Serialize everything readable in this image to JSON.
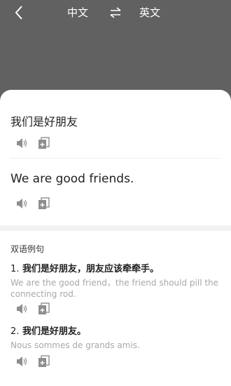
{
  "header": {
    "source_lang": "中文",
    "target_lang": "英文",
    "icons": {
      "back": "chevron-left-icon",
      "swap": "swap-arrows-icon"
    }
  },
  "translation": {
    "source_text": "我们是好朋友",
    "target_text": "We are good friends."
  },
  "examples": {
    "title": "双语例句",
    "items": [
      {
        "number": "1.",
        "cn": "我们是好朋友，朋友应该牵牵手。",
        "en": "We are the good friend，the friend should pill the connecting rod."
      },
      {
        "number": "2.",
        "cn": "我们是好朋友。",
        "en": "Nous sommes de grands amis."
      }
    ]
  },
  "colors": {
    "header_bg": "#616161",
    "card_bg": "#ffffff",
    "muted_text": "#a8a8a8",
    "icon": "#8e8e8e"
  }
}
